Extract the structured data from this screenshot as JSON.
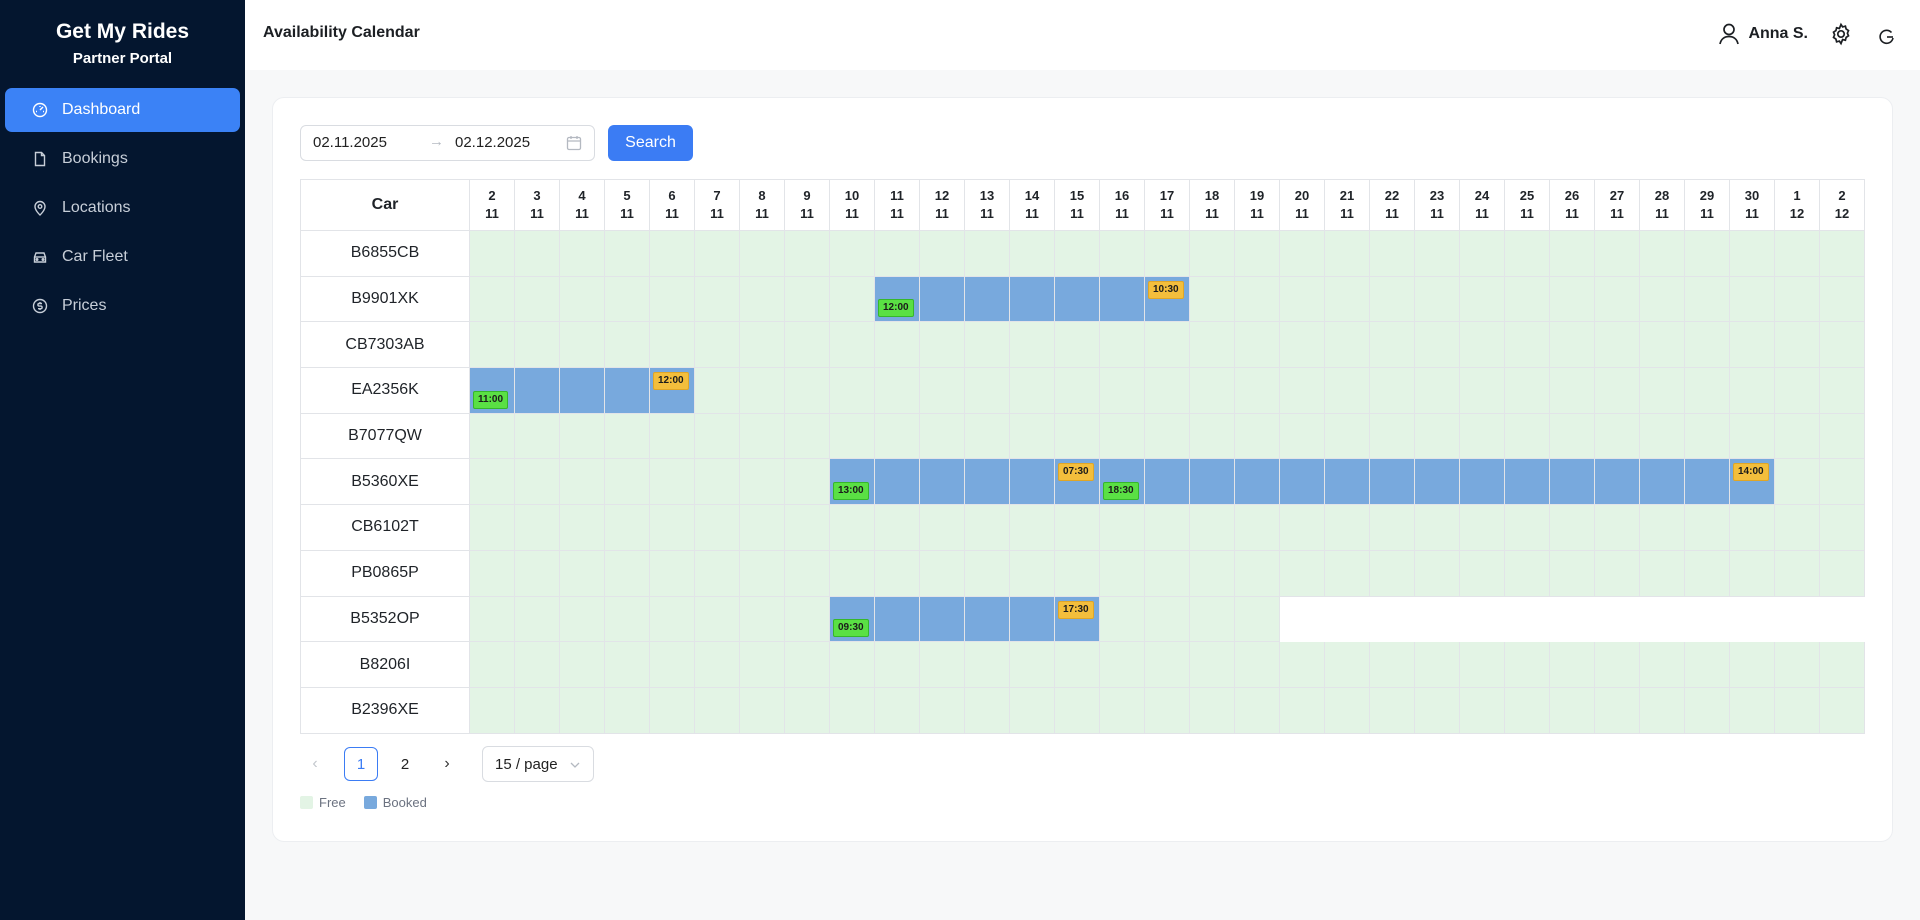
{
  "brand": {
    "title": "Get My Rides",
    "subtitle": "Partner Portal"
  },
  "sidebar": {
    "items": [
      {
        "label": "Dashboard",
        "icon": "dashboard-icon",
        "active": true
      },
      {
        "label": "Bookings",
        "icon": "file-icon",
        "active": false
      },
      {
        "label": "Locations",
        "icon": "map-pin-icon",
        "active": false
      },
      {
        "label": "Car Fleet",
        "icon": "car-icon",
        "active": false
      },
      {
        "label": "Prices",
        "icon": "dollar-icon",
        "active": false
      }
    ]
  },
  "header": {
    "title": "Availability Calendar",
    "user_name": "Anna S."
  },
  "filters": {
    "from": "02.11.2025",
    "to": "02.12.2025",
    "search_label": "Search"
  },
  "calendar": {
    "car_header": "Car",
    "days": [
      [
        "2",
        "11"
      ],
      [
        "3",
        "11"
      ],
      [
        "4",
        "11"
      ],
      [
        "5",
        "11"
      ],
      [
        "6",
        "11"
      ],
      [
        "7",
        "11"
      ],
      [
        "8",
        "11"
      ],
      [
        "9",
        "11"
      ],
      [
        "10",
        "11"
      ],
      [
        "11",
        "11"
      ],
      [
        "12",
        "11"
      ],
      [
        "13",
        "11"
      ],
      [
        "14",
        "11"
      ],
      [
        "15",
        "11"
      ],
      [
        "16",
        "11"
      ],
      [
        "17",
        "11"
      ],
      [
        "18",
        "11"
      ],
      [
        "19",
        "11"
      ],
      [
        "20",
        "11"
      ],
      [
        "21",
        "11"
      ],
      [
        "22",
        "11"
      ],
      [
        "23",
        "11"
      ],
      [
        "24",
        "11"
      ],
      [
        "25",
        "11"
      ],
      [
        "26",
        "11"
      ],
      [
        "27",
        "11"
      ],
      [
        "28",
        "11"
      ],
      [
        "29",
        "11"
      ],
      [
        "30",
        "11"
      ],
      [
        "1",
        "12"
      ],
      [
        "2",
        "12"
      ]
    ],
    "rows": [
      {
        "car": "B6855CB",
        "bookings": []
      },
      {
        "car": "B9901XK",
        "bookings": [
          {
            "from": 9,
            "to": 15,
            "start": "12:00",
            "end": "10:30"
          }
        ]
      },
      {
        "car": "CB7303AB",
        "bookings": []
      },
      {
        "car": "EA2356K",
        "bookings": [
          {
            "from": 0,
            "to": 4,
            "start": "11:00",
            "end": "12:00"
          }
        ]
      },
      {
        "car": "B7077QW",
        "bookings": []
      },
      {
        "car": "B5360XE",
        "bookings": [
          {
            "from": 8,
            "to": 13,
            "start": "13:00",
            "end": "07:30"
          },
          {
            "from": 14,
            "to": 28,
            "start": "18:30",
            "end": "14:00"
          }
        ]
      },
      {
        "car": "CB6102T",
        "bookings": []
      },
      {
        "car": "PB0865P",
        "bookings": []
      },
      {
        "car": "B5352OP",
        "bookings": [
          {
            "from": 8,
            "to": 13,
            "start": "09:30",
            "end": "17:30"
          }
        ],
        "available_until": 17
      },
      {
        "car": "B8206I",
        "bookings": []
      },
      {
        "car": "B2396XE",
        "bookings": []
      }
    ]
  },
  "pagination": {
    "pages": [
      "1",
      "2"
    ],
    "current": "1",
    "page_size": "15 / page"
  },
  "legend": {
    "free": "Free",
    "booked": "Booked"
  },
  "colors": {
    "accent": "#3b7cf4",
    "free": "#e3f4e5",
    "booked": "#78a9dd",
    "start_tag": "#5ae044",
    "end_tag": "#f3be3c",
    "sidebar": "#04162f"
  }
}
